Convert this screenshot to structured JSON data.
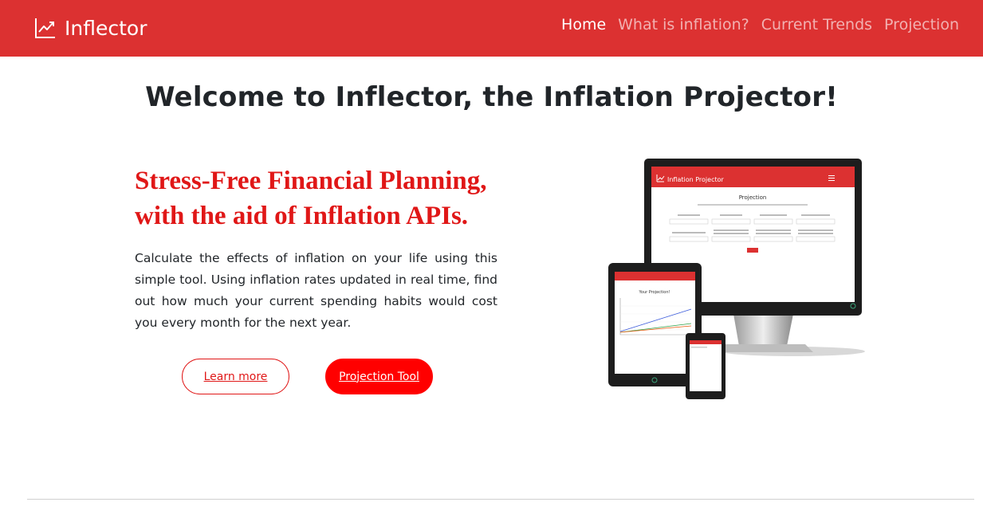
{
  "navbar": {
    "brand": "Inflector",
    "brand_icon": "trend-up-icon",
    "background": "#dc3131",
    "links": [
      {
        "label": "Home",
        "active": true
      },
      {
        "label": "What is inflation?",
        "active": false
      },
      {
        "label": "Current Trends",
        "active": false
      },
      {
        "label": "Projection",
        "active": false
      }
    ]
  },
  "page": {
    "title": "Welcome to Inflector, the Inflation Projector!"
  },
  "hero": {
    "heading_line1": "Stress-Free Financial Planning,",
    "heading_line2": "with the aid of Inflation APIs.",
    "body": "Calculate the effects of inflation on your life using this simple tool. Using inflation rates updated in real time, find out how much your current spending habits would cost you every month for the next year.",
    "accent_color": "#e01717",
    "buttons": {
      "learn_more": "Learn more",
      "projection_tool": "Projection Tool"
    }
  },
  "mockup": {
    "monitor_app_title": "Inflation Projector",
    "monitor_page_title": "Projection",
    "tablet_page_title": "Your Projection!"
  }
}
